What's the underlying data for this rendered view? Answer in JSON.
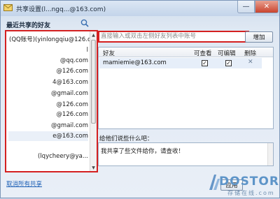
{
  "window": {
    "title": "共享设置(l...ngq...@163.com)",
    "minimize_glyph": "—",
    "close_glyph": "✕"
  },
  "left": {
    "recent_label": "最近共享的好友",
    "contacts": [
      "(QQ账号)(yinlongqiu@126.c...",
      "l",
      "@qq.com",
      "@126.com",
      "4@163.com",
      "@gmail.com",
      "@126.com",
      "@126.com",
      "@gmail.com",
      "e@163.com",
      "(lqycheery@ya..."
    ],
    "cancel_all": "取消所有共享"
  },
  "right": {
    "account_placeholder": "直接输入或双击左侧好友列表中账号",
    "add_button": "增加",
    "columns": [
      "好友",
      "可查看",
      "可编辑",
      "删除"
    ],
    "rows": [
      {
        "friend": "mamiemie@163.com",
        "can_view": true,
        "can_edit": true,
        "delete_glyph": "✕"
      }
    ],
    "message_label": "给他们说些什么吧：",
    "message_text": "我共享了些文件给你，请查收！",
    "apply_button": "应用"
  },
  "watermark": {
    "logo_text": "DOSTOR",
    "sub_text": "存储在线.com"
  },
  "colors": {
    "highlight_border": "#d42020",
    "link": "#1c5fb5",
    "selected_row": "#e6eef9"
  }
}
